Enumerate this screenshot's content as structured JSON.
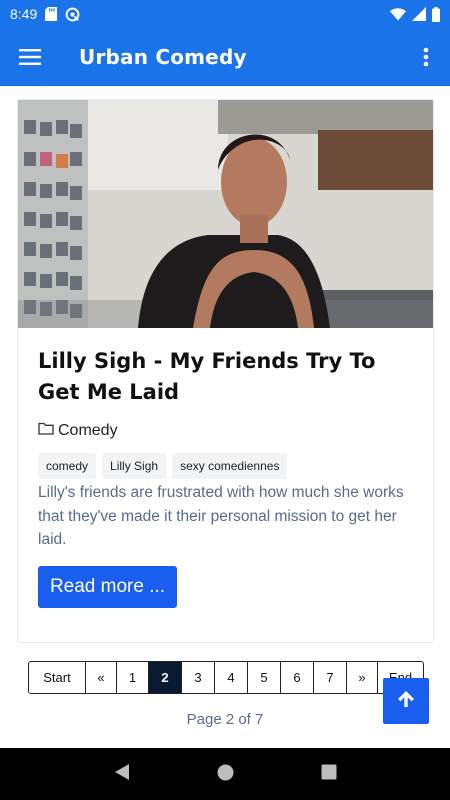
{
  "status_bar": {
    "time": "8:49"
  },
  "app_bar": {
    "title": "Urban Comedy",
    "menu_icon": "hamburger-menu-icon",
    "more_icon": "more-vert-icon"
  },
  "post": {
    "title": "Lilly Sigh - My Friends Try To Get Me Laid",
    "category": "Comedy",
    "tags": [
      "comedy",
      "Lilly Sigh",
      "sexy comediennes"
    ],
    "excerpt": "Lilly's friends are frustrated with how much she works that they've made it their personal mission to get her laid.",
    "read_more": "Read more ..."
  },
  "pagination": {
    "items": [
      "Start",
      "«",
      "1",
      "2",
      "3",
      "4",
      "5",
      "6",
      "7",
      "»",
      "End"
    ],
    "active": "2",
    "info": "Page 2 of 7"
  },
  "colors": {
    "primary": "#1a73e8",
    "button": "#1a5ef0",
    "active_page": "#0b1a33",
    "muted_text": "#5a6a8e"
  }
}
